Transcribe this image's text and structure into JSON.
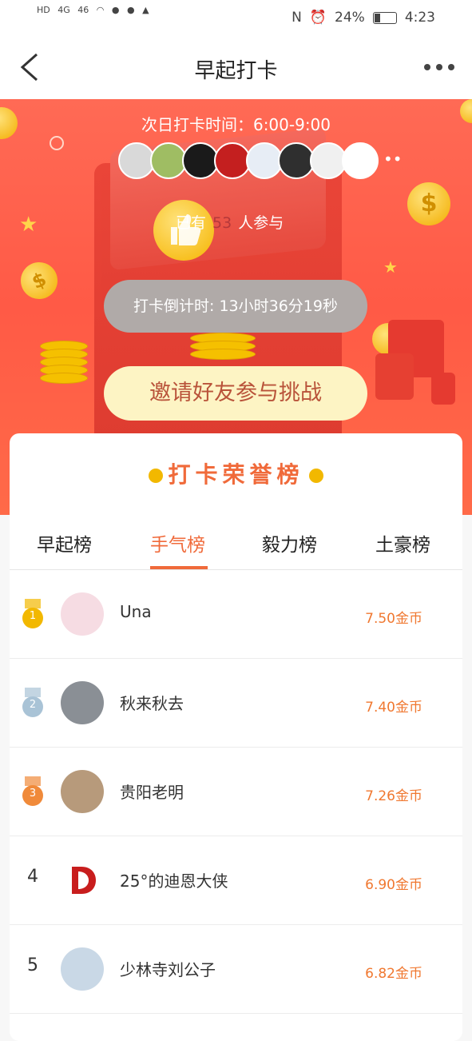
{
  "status_bar": {
    "left_indicators": [
      "HD",
      "4G",
      "46"
    ],
    "battery": "24%",
    "time": "4:23"
  },
  "nav": {
    "title": "早起打卡"
  },
  "hero": {
    "next_checkin_time": "次日打卡时间：6:00-9:00",
    "participants_prefix": "已有",
    "participants_count": "53",
    "participants_suffix": "人参与",
    "countdown": "打卡倒计时: 13小时36分19秒",
    "invite_button": "邀请好友参与挑战",
    "avatar_colors": [
      "#d9d9d9",
      "#9fbd63",
      "#1a1a1a",
      "#c41f1f",
      "#e7edf5",
      "#2f2f2f",
      "#f0f0f0",
      "#ffffff"
    ]
  },
  "ranking": {
    "heading": "打卡荣誉榜",
    "tabs": [
      {
        "label": "早起榜"
      },
      {
        "label": "手气榜"
      },
      {
        "label": "毅力榜"
      },
      {
        "label": "土豪榜"
      }
    ],
    "active_tab": "手气榜",
    "rows": [
      {
        "rank": "1",
        "name": "Una",
        "coins": "7.50金币",
        "medal_color": "#f2b800"
      },
      {
        "rank": "2",
        "name": "秋来秋去",
        "coins": "7.40金币",
        "medal_color": "#a9c3d6"
      },
      {
        "rank": "3",
        "name": "贵阳老明",
        "coins": "7.26金币",
        "medal_color": "#f08a3a"
      },
      {
        "rank": "4",
        "name": "25°的迪恩大侠",
        "coins": "6.90金币"
      },
      {
        "rank": "5",
        "name": "少林寺刘公子",
        "coins": "6.82金币"
      }
    ]
  }
}
